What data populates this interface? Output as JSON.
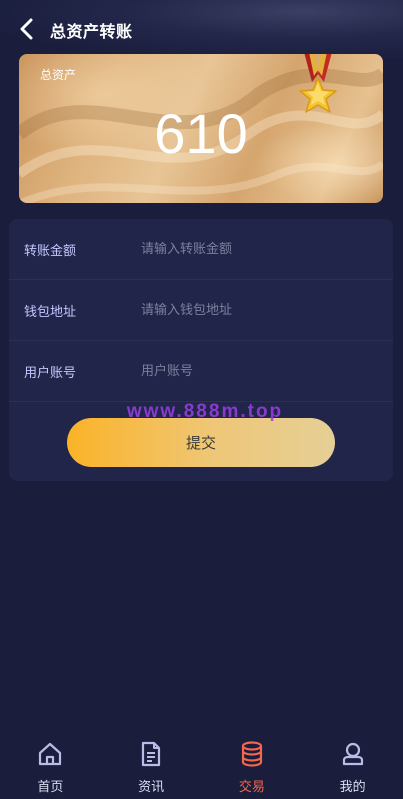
{
  "header": {
    "title": "总资产转账"
  },
  "asset_card": {
    "label": "总资产",
    "value": "610"
  },
  "form": {
    "fields": [
      {
        "label": "转账金额",
        "placeholder": "请输入转账金额",
        "value": ""
      },
      {
        "label": "钱包地址",
        "placeholder": "请输入钱包地址",
        "value": ""
      },
      {
        "label": "用户账号",
        "placeholder": "用户账号",
        "value": ""
      }
    ],
    "submit_label": "提交"
  },
  "watermark": "www.888m.top",
  "tabbar": {
    "active": "交易",
    "items": [
      {
        "label": "首页",
        "icon": "home-icon"
      },
      {
        "label": "资讯",
        "icon": "document-icon"
      },
      {
        "label": "交易",
        "icon": "coins-icon"
      },
      {
        "label": "我的",
        "icon": "user-icon"
      }
    ]
  },
  "colors": {
    "background": "#1a1d3c",
    "card": "#21254a",
    "field_label": "#c5c9ff",
    "active_tab": "#f3674d",
    "button_gradient_start": "#fbb327",
    "button_gradient_end": "#e5cf96"
  }
}
